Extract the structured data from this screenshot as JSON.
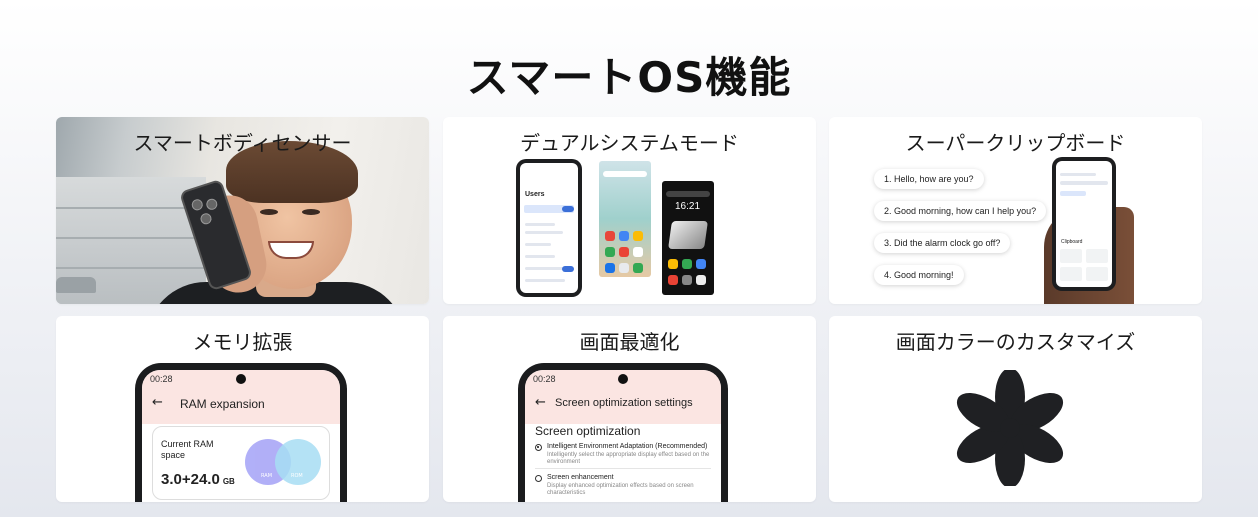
{
  "page_title": "スマートOS機能",
  "cards": [
    {
      "title": "スマートボディセンサー"
    },
    {
      "title": "デュアルシステムモード"
    },
    {
      "title": "スーパークリップボード"
    },
    {
      "title": "メモリ拡張"
    },
    {
      "title": "画面最適化"
    },
    {
      "title": "画面カラーのカスタマイズ"
    }
  ],
  "dual_mode": {
    "users_title": "Users",
    "clock_time": "16:21"
  },
  "clipboard": {
    "messages": [
      "1. Hello, how are you?",
      "2. Good morning, how can I help you?",
      "3. Did the alarm clock go off?",
      "4. Good morning!"
    ],
    "panel_label": "Clipboard"
  },
  "ram": {
    "status_time": "00:28",
    "header": "RAM expansion",
    "label_line1": "Current RAM",
    "label_line2": "space",
    "value": "3.0+24.0",
    "unit": "GB",
    "circle_a": "RAM",
    "circle_b": "ROM",
    "circle_a_color": "#a9a7f7",
    "circle_b_color": "#a7def4"
  },
  "screen_opt": {
    "status_time": "00:28",
    "header": "Screen optimization settings",
    "section": "Screen optimization",
    "options": [
      {
        "label": "Intelligent Environment Adaptation (Recommended)",
        "desc1": "Intelligently select the appropriate display effect based on the",
        "desc2": "environment",
        "selected": true
      },
      {
        "label": "Screen enhancement",
        "desc1": "Display enhanced optimization effects based on screen",
        "desc2": "characteristics",
        "selected": false
      }
    ]
  },
  "colors": {
    "flower": "#1f2023",
    "header_tint": "#fbe5e2"
  },
  "icons": [
    "flower-icon",
    "back-arrow-icon",
    "camera-icon"
  ]
}
